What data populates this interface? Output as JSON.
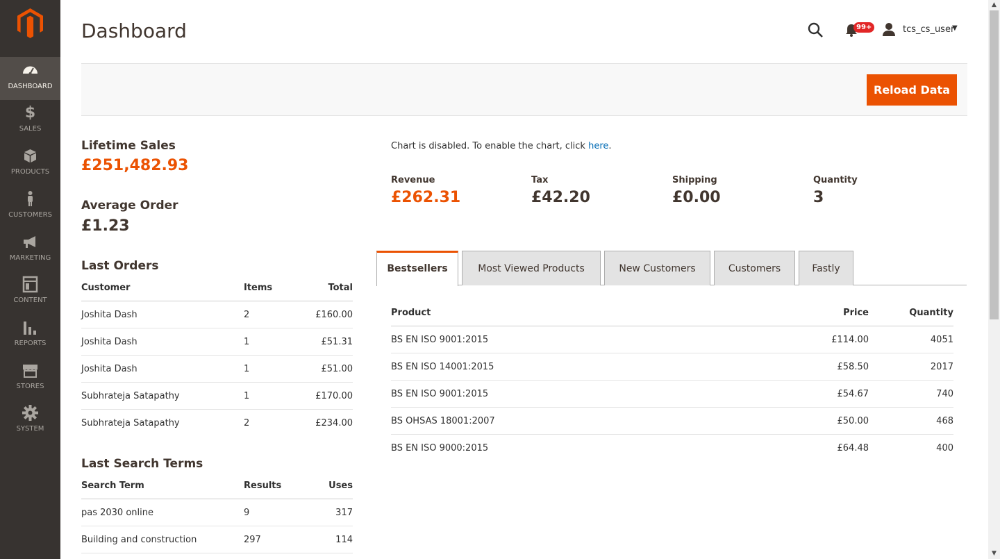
{
  "sidebar": {
    "items": [
      {
        "label": "DASHBOARD",
        "icon": "dashboard-icon",
        "active": true
      },
      {
        "label": "SALES",
        "icon": "dollar-icon"
      },
      {
        "label": "PRODUCTS",
        "icon": "box-icon"
      },
      {
        "label": "CUSTOMERS",
        "icon": "person-icon"
      },
      {
        "label": "MARKETING",
        "icon": "megaphone-icon"
      },
      {
        "label": "CONTENT",
        "icon": "layout-icon"
      },
      {
        "label": "REPORTS",
        "icon": "bar-chart-icon"
      },
      {
        "label": "STORES",
        "icon": "store-icon"
      },
      {
        "label": "SYSTEM",
        "icon": "gear-icon"
      }
    ]
  },
  "header": {
    "title": "Dashboard",
    "notifications_badge": "99+",
    "user_name": "tcs_cs_user"
  },
  "actions": {
    "reload_label": "Reload Data"
  },
  "lifetime_sales": {
    "label": "Lifetime Sales",
    "value": "£251,482.93"
  },
  "average_order": {
    "label": "Average Order",
    "value": "£1.23"
  },
  "last_orders": {
    "title": "Last Orders",
    "columns": [
      "Customer",
      "Items",
      "Total"
    ],
    "rows": [
      {
        "customer": "Joshita Dash",
        "items": "2",
        "total": "£160.00"
      },
      {
        "customer": "Joshita Dash",
        "items": "1",
        "total": "£51.31"
      },
      {
        "customer": "Joshita Dash",
        "items": "1",
        "total": "£51.00"
      },
      {
        "customer": "Subhrateja Satapathy",
        "items": "1",
        "total": "£170.00"
      },
      {
        "customer": "Subhrateja Satapathy",
        "items": "2",
        "total": "£234.00"
      }
    ]
  },
  "last_search_terms": {
    "title": "Last Search Terms",
    "columns": [
      "Search Term",
      "Results",
      "Uses"
    ],
    "rows": [
      {
        "term": "pas 2030 online",
        "results": "9",
        "uses": "317"
      },
      {
        "term": "Building and construction",
        "results": "297",
        "uses": "114"
      }
    ]
  },
  "chart_message": {
    "text": "Chart is disabled. To enable the chart, click ",
    "link": "here",
    "suffix": "."
  },
  "totals": {
    "revenue": {
      "label": "Revenue",
      "value": "£262.31"
    },
    "tax": {
      "label": "Tax",
      "value": "£42.20"
    },
    "shipping": {
      "label": "Shipping",
      "value": "£0.00"
    },
    "quantity": {
      "label": "Quantity",
      "value": "3"
    }
  },
  "tabs": [
    "Bestsellers",
    "Most Viewed Products",
    "New Customers",
    "Customers",
    "Fastly"
  ],
  "bestsellers": {
    "columns": [
      "Product",
      "Price",
      "Quantity"
    ],
    "rows": [
      {
        "product": "BS EN ISO 9001:2015",
        "price": "£114.00",
        "quantity": "4051"
      },
      {
        "product": "BS EN ISO 14001:2015",
        "price": "£58.50",
        "quantity": "2017"
      },
      {
        "product": "BS EN ISO 9001:2015",
        "price": "£54.67",
        "quantity": "740"
      },
      {
        "product": "BS OHSAS 18001:2007",
        "price": "£50.00",
        "quantity": "468"
      },
      {
        "product": "BS EN ISO 9000:2015",
        "price": "£64.48",
        "quantity": "400"
      }
    ]
  },
  "colors": {
    "accent": "#eb5202",
    "sidebar": "#373330",
    "link": "#006bb4"
  }
}
